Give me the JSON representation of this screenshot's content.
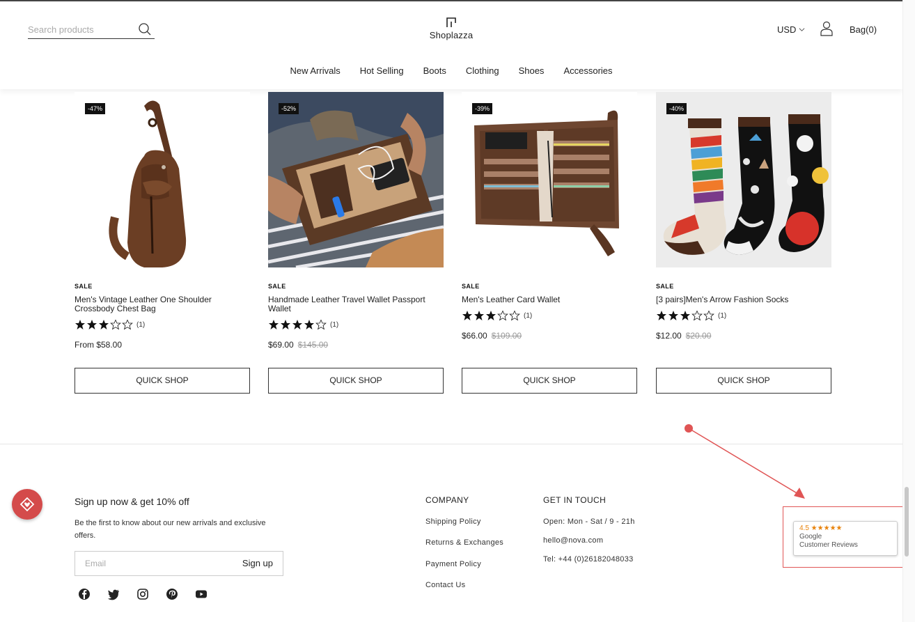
{
  "header": {
    "search_placeholder": "Search products",
    "logo_text": "Shoplazza",
    "currency": "USD",
    "bag": "Bag(0)"
  },
  "nav": [
    "New Arrivals",
    "Hot Selling",
    "Boots",
    "Clothing",
    "Shoes",
    "Accessories"
  ],
  "products": [
    {
      "badge": "-47%",
      "sale": "SALE",
      "title": "Men's Vintage Leather One Shoulder Crossbody Chest Bag",
      "stars": 3,
      "reviews": "(1)",
      "price": "From $58.00",
      "compare_price": "",
      "button": "QUICK SHOP"
    },
    {
      "badge": "-52%",
      "sale": "SALE",
      "title": "Handmade Leather Travel Wallet Passport Wallet",
      "stars": 4,
      "reviews": "(1)",
      "price": "$69.00",
      "compare_price": "$145.00",
      "button": "QUICK SHOP"
    },
    {
      "badge": "-39%",
      "sale": "SALE",
      "title": "Men's Leather Card Wallet",
      "stars": 3,
      "reviews": "(1)",
      "price": "$66.00",
      "compare_price": "$109.00",
      "button": "QUICK SHOP"
    },
    {
      "badge": "-40%",
      "sale": "SALE",
      "title": "[3 pairs]Men's Arrow Fashion Socks",
      "stars": 3,
      "reviews": "(1)",
      "price": "$12.00",
      "compare_price": "$20.00",
      "button": "QUICK SHOP"
    }
  ],
  "footer": {
    "signup_title": "Sign up now & get 10% off",
    "signup_desc": "Be the first to know about our new arrivals and exclusive offers.",
    "email_placeholder": "Email",
    "signup_button": "Sign up",
    "company": {
      "heading": "COMPANY",
      "links": [
        "Shipping Policy",
        "Returns & Exchanges",
        "Payment Policy",
        "Contact Us"
      ]
    },
    "contact": {
      "heading": "GET IN TOUCH",
      "lines": [
        "Open: Mon - Sat / 9 - 21h",
        "hello@nova.com",
        "Tel: +44 (0)26182048033"
      ]
    },
    "socials": [
      "facebook-icon",
      "twitter-icon",
      "instagram-icon",
      "pinterest-icon",
      "youtube-icon"
    ]
  },
  "reviews_badge": {
    "rating": "4.5 ★★★★★",
    "line1": "Google",
    "line2": "Customer Reviews"
  },
  "colors": {
    "accent_red": "#e05555",
    "heart_button": "#d44b4b",
    "review_orange": "#e8830c"
  }
}
